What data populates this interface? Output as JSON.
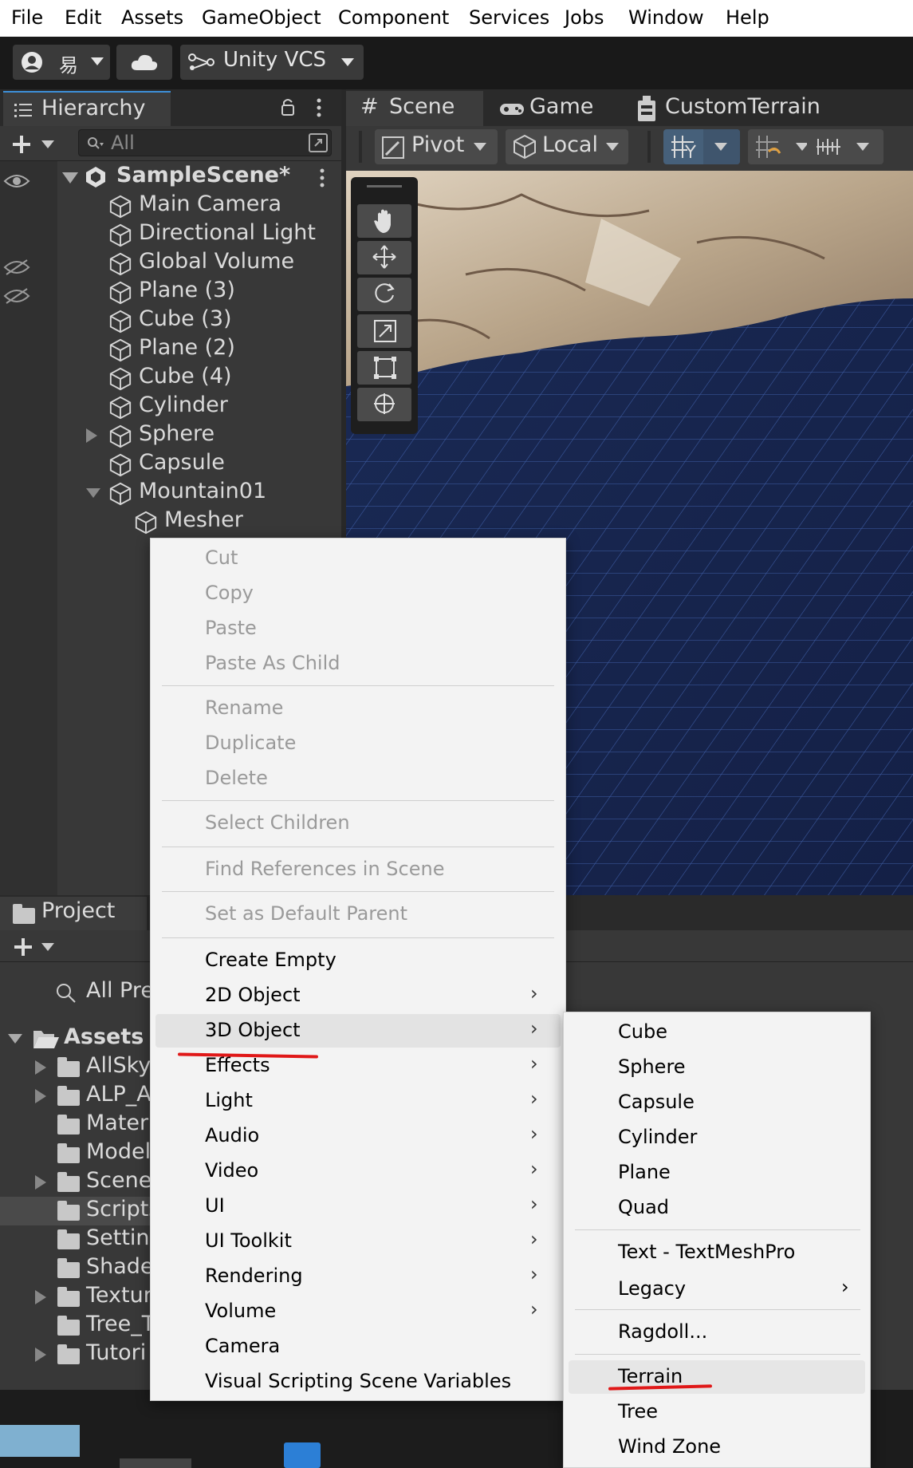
{
  "menubar": [
    "File",
    "Edit",
    "Assets",
    "GameObject",
    "Component",
    "Services",
    "Jobs",
    "Window",
    "Help"
  ],
  "toolbar": {
    "account_label": "易",
    "vcs_label": "Unity VCS"
  },
  "hierarchy": {
    "tab_label": "Hierarchy",
    "search_placeholder": "All",
    "scene_name": "SampleScene*",
    "items": [
      "Main Camera",
      "Directional Light",
      "Global Volume",
      "Plane (3)",
      "Cube (3)",
      "Plane (2)",
      "Cube (4)",
      "Cylinder",
      "Sphere",
      "Capsule",
      "Mountain01",
      "Mesher"
    ]
  },
  "scene": {
    "tabs": [
      "Scene",
      "Game",
      "CustomTerrain"
    ],
    "pivot_label": "Pivot",
    "local_label": "Local"
  },
  "project": {
    "tab_label": "Project",
    "all_prefix": "All Pre",
    "assets_label": "Assets",
    "folders": [
      "AllSky",
      "ALP_A",
      "Materi",
      "Model",
      "Scene",
      "Scripts",
      "Setting",
      "Shade",
      "Textur",
      "Tree_T",
      "Tutori"
    ]
  },
  "context_menu": {
    "disabled_group_1": [
      "Cut",
      "Copy",
      "Paste",
      "Paste As Child"
    ],
    "disabled_group_2": [
      "Rename",
      "Duplicate",
      "Delete"
    ],
    "select_children": "Select Children",
    "find_references": "Find References in Scene",
    "set_default_parent": "Set as Default Parent",
    "items": [
      "Create Empty",
      "2D Object",
      "3D Object",
      "Effects",
      "Light",
      "Audio",
      "Video",
      "UI",
      "UI Toolkit",
      "Rendering",
      "Volume",
      "Camera",
      "Visual Scripting Scene Variables"
    ],
    "highlighted": "3D Object"
  },
  "submenu_3d": {
    "group_1": [
      "Cube",
      "Sphere",
      "Capsule",
      "Cylinder",
      "Plane",
      "Quad"
    ],
    "group_2": [
      "Text - TextMeshPro",
      "Legacy"
    ],
    "group_3": [
      "Ragdoll..."
    ],
    "group_4": [
      "Terrain",
      "Tree",
      "Wind Zone"
    ],
    "hovered": "Terrain"
  },
  "colors": {
    "annotation_red": "#e01818",
    "accent_blue": "#3d8fd8",
    "grid_blue": "#1d2d57"
  }
}
